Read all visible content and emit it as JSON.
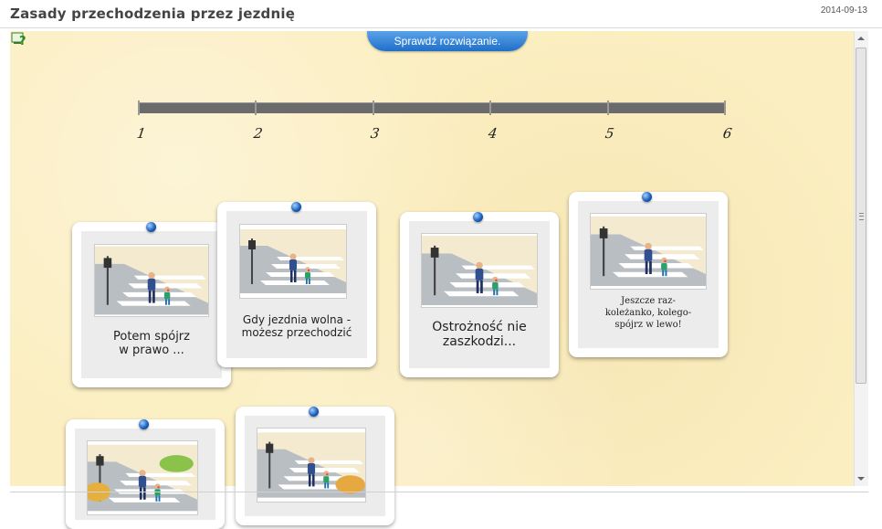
{
  "header": {
    "title": "Zasady przechodzenia przez jezdnię",
    "date": "2014-09-13"
  },
  "toolbar": {
    "check_label": "Sprawdź rozwiązanie."
  },
  "timeline": {
    "numbers": [
      "1",
      "2",
      "3",
      "4",
      "5",
      "6"
    ]
  },
  "cards": [
    {
      "caption": "Potem spójrz\nw prawo ..."
    },
    {
      "caption": "Gdy jezdnia wolna -\nmożesz przechodzić"
    },
    {
      "caption": "Ostrożność nie\nzaszkodzi..."
    },
    {
      "caption": "Jeszcze raz-\nkoleżanko, kolego-\nspójrz w lewo!"
    }
  ],
  "colors": {
    "stage_bg": "#fbeec0",
    "button": "#1f6fc9",
    "pin": "#1559b7"
  }
}
